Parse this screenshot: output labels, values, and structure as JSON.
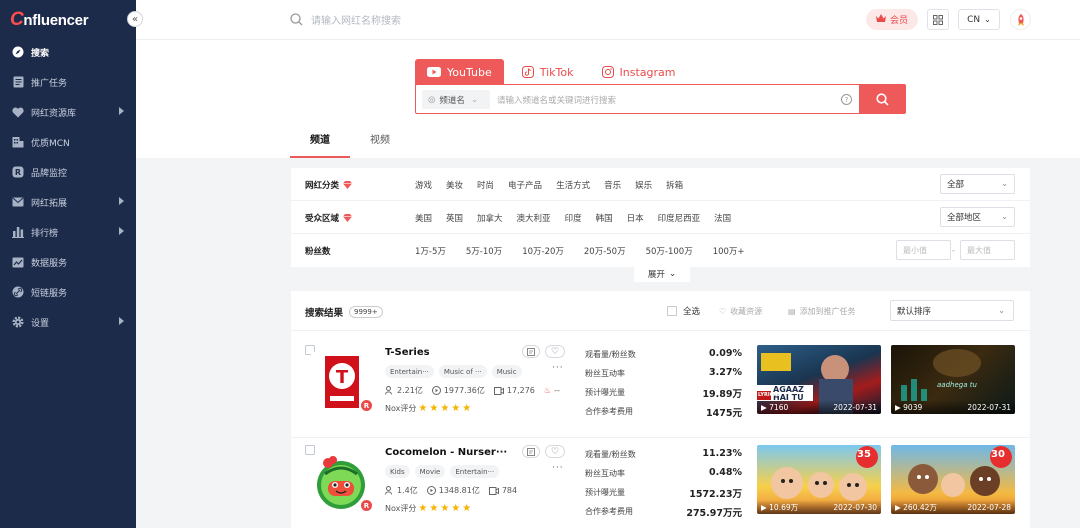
{
  "app": {
    "logo": "nfluencer"
  },
  "sidebar": {
    "items": [
      {
        "label": "搜索",
        "icon": "compass-icon",
        "active": true
      },
      {
        "label": "推广任务",
        "icon": "task-icon"
      },
      {
        "label": "网红资源库",
        "icon": "heart-icon",
        "arrow": true
      },
      {
        "label": "优质MCN",
        "icon": "building-icon"
      },
      {
        "label": "品牌监控",
        "icon": "brand-icon"
      },
      {
        "label": "网红拓展",
        "icon": "mail-icon",
        "arrow": true
      },
      {
        "label": "排行榜",
        "icon": "bar-chart-icon",
        "arrow": true
      },
      {
        "label": "数据服务",
        "icon": "data-icon"
      },
      {
        "label": "短链服务",
        "icon": "link-icon"
      },
      {
        "label": "设置",
        "icon": "gear-icon",
        "arrow": true
      }
    ]
  },
  "topbar": {
    "search_placeholder": "请输入网红名称搜索",
    "vip_label": "会员",
    "lang": "CN"
  },
  "search": {
    "platforms": [
      "YouTube",
      "TikTok",
      "Instagram"
    ],
    "field_select": "频道名",
    "placeholder": "请输入频道名或关键词进行搜索",
    "view_tabs": [
      "频道",
      "视频"
    ]
  },
  "filters": {
    "category": {
      "label": "网红分类",
      "options": [
        "游戏",
        "美妆",
        "时尚",
        "电子产品",
        "生活方式",
        "音乐",
        "娱乐",
        "拆箱"
      ],
      "select": "全部"
    },
    "region": {
      "label": "受众区域",
      "options": [
        "美国",
        "英国",
        "加拿大",
        "澳大利亚",
        "印度",
        "韩国",
        "日本",
        "印度尼西亚",
        "法国"
      ],
      "select": "全部地区"
    },
    "fans": {
      "label": "粉丝数",
      "options": [
        "1万-5万",
        "5万-10万",
        "10万-20万",
        "20万-50万",
        "50万-100万",
        "100万+"
      ],
      "min_placeholder": "最小值",
      "max_placeholder": "最大值"
    },
    "expand_label": "展开"
  },
  "results": {
    "title": "搜索结果",
    "count": "9999+",
    "select_all": "全选",
    "collect": "收藏资源",
    "add_task": "添加到推广任务",
    "sort": "默认排序",
    "metric_labels": [
      "观看量/粉丝数",
      "粉丝互动率",
      "预计曝光量",
      "合作参考费用"
    ],
    "nox_label": "Nox评分",
    "items": [
      {
        "name": "T-Series",
        "tags": [
          "Entertain···",
          "Music of ···",
          "Music"
        ],
        "subs": "2.21亿",
        "views": "1977.36亿",
        "videos": "17,276",
        "extra": "--",
        "metrics": [
          "0.09%",
          "3.27%",
          "19.89万",
          "1475元"
        ],
        "videos_list": [
          {
            "views": "7160",
            "date": "2022-07-31",
            "overlay": "AGAAZ HAI TU",
            "tag": "LYRICAL"
          },
          {
            "views": "9039",
            "date": "2022-07-31"
          }
        ]
      },
      {
        "name": "Cocomelon - Nurser···",
        "tags": [
          "Kids",
          "Movie",
          "Entertain···"
        ],
        "subs": "1.4亿",
        "views": "1348.81亿",
        "videos": "784",
        "metrics": [
          "11.23%",
          "0.48%",
          "1572.23万",
          "275.97万元"
        ],
        "videos_list": [
          {
            "views": "10.69万",
            "date": "2022-07-30",
            "badge": "35"
          },
          {
            "views": "260.42万",
            "date": "2022-07-28",
            "badge": "30"
          }
        ]
      }
    ]
  },
  "colors": {
    "accent": "#ee5a5a",
    "sidebar": "#1d2b4a",
    "star": "#f5b400"
  }
}
